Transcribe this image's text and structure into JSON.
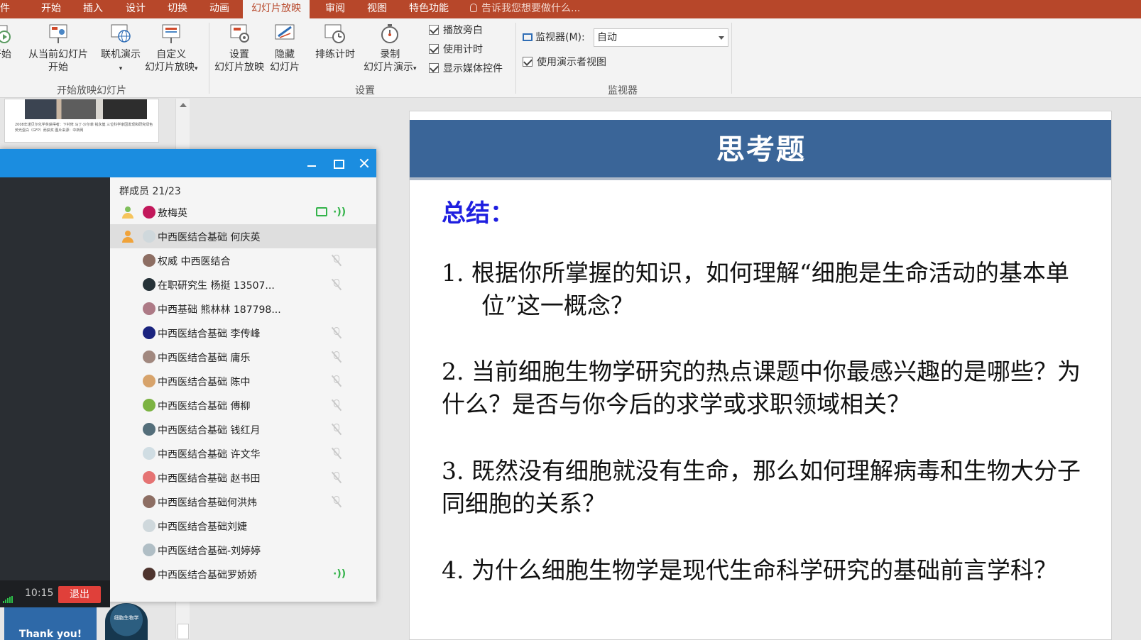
{
  "ribbon_tabs": [
    "文件",
    "开始",
    "插入",
    "设计",
    "切换",
    "动画",
    "幻灯片放映",
    "审阅",
    "视图",
    "特色功能"
  ],
  "active_tab": "幻灯片放映",
  "tell_me": "告诉我您想要做什么...",
  "ribbon": {
    "from_start": "开始",
    "from_current_line1": "从当前幻灯片",
    "from_current_line2": "开始",
    "online_present": "联机演示",
    "custom_line1": "自定义",
    "custom_line2": "幻灯片放映",
    "setup_line1": "设置",
    "setup_line2": "幻灯片放映",
    "hide_line1": "隐藏",
    "hide_line2": "幻灯片",
    "rehearse": "排练计时",
    "record_line1": "录制",
    "record_line2": "幻灯片演示",
    "chk_narration": "播放旁白",
    "chk_timing": "使用计时",
    "chk_media": "显示媒体控件",
    "monitor_label": "监视器(M):",
    "monitor_value": "自动",
    "chk_presenter": "使用演示者视图",
    "group_start": "开始放映幻灯片",
    "group_setup": "设置",
    "group_monitor": "监视器"
  },
  "thumbnails": {
    "thumb1_caption": "2008年诺贝尔化学奖获得者：下村修 马丁·沙尔菲 钱永健 三位科学家因发现和研究绿色荧光蛋白（GFP）而获奖 图片来源：中新网",
    "thumb2_text": "Thank you!",
    "thumb3_text": "细胞生物学"
  },
  "slide": {
    "title": "思考题",
    "summary": "总结：",
    "q1": "1.  根据你所掌握的知识，如何理解“细胞是生命活动的基本单位”这一概念？",
    "q2": "2.  当前细胞生物学研究的热点课题中你最感兴趣的是哪些？为什么？是否与你今后的求学或求职领域相关？",
    "q3": "3. 既然没有细胞就没有生命，那么如何理解病毒和生物大分子同细胞的关系？",
    "q4": "4. 为什么细胞生物学是现代生命科学研究的基础前言学科？"
  },
  "chat": {
    "members_header": "群成员 21/23",
    "call_time": "10:15",
    "exit_label": "退出",
    "members": [
      {
        "name": "敖梅英",
        "role": "owner",
        "state": "screen-speaking",
        "avatar_color": "#c2185b"
      },
      {
        "name": "中西医结合基础 何庆英",
        "role": "admin",
        "state": "none",
        "avatar_color": "#cfd8dc"
      },
      {
        "name": "权威 中西医结合",
        "role": "",
        "state": "muted",
        "avatar_color": "#8d6e63"
      },
      {
        "name": "在职研究生  杨挺  13507...",
        "role": "",
        "state": "muted",
        "avatar_color": "#263238"
      },
      {
        "name": "中西基础 熊林林 187798...",
        "role": "",
        "state": "none",
        "avatar_color": "#ad7a86"
      },
      {
        "name": "中西医结合基础  李传峰",
        "role": "",
        "state": "muted",
        "avatar_color": "#1a237e"
      },
      {
        "name": "中西医结合基础  庸乐",
        "role": "",
        "state": "muted",
        "avatar_color": "#a1887f"
      },
      {
        "name": "中西医结合基础 陈中",
        "role": "",
        "state": "muted",
        "avatar_color": "#d7a36b"
      },
      {
        "name": "中西医结合基础 傅柳",
        "role": "",
        "state": "muted",
        "avatar_color": "#7cb342"
      },
      {
        "name": "中西医结合基础 钱红月",
        "role": "",
        "state": "muted",
        "avatar_color": "#546e7a"
      },
      {
        "name": "中西医结合基础 许文华",
        "role": "",
        "state": "muted",
        "avatar_color": "#d0dde3"
      },
      {
        "name": "中西医结合基础 赵书田",
        "role": "",
        "state": "muted",
        "avatar_color": "#e57373"
      },
      {
        "name": "中西医结合基础何洪炜",
        "role": "",
        "state": "muted",
        "avatar_color": "#8d6e63"
      },
      {
        "name": "中西医结合基础刘婕",
        "role": "",
        "state": "none",
        "avatar_color": "#cfd8dc"
      },
      {
        "name": "中西医结合基础-刘婷婷",
        "role": "",
        "state": "none",
        "avatar_color": "#b0bec5"
      },
      {
        "name": "中西医结合基础罗娇娇",
        "role": "",
        "state": "speaking",
        "avatar_color": "#4e342e"
      }
    ]
  },
  "colors": {
    "ribbon_accent": "#b7472a",
    "slide_header": "#3a6598",
    "summary_blue": "#1f1fe0",
    "chat_titlebar": "#1b8de0",
    "exit_red": "#e0403a"
  }
}
